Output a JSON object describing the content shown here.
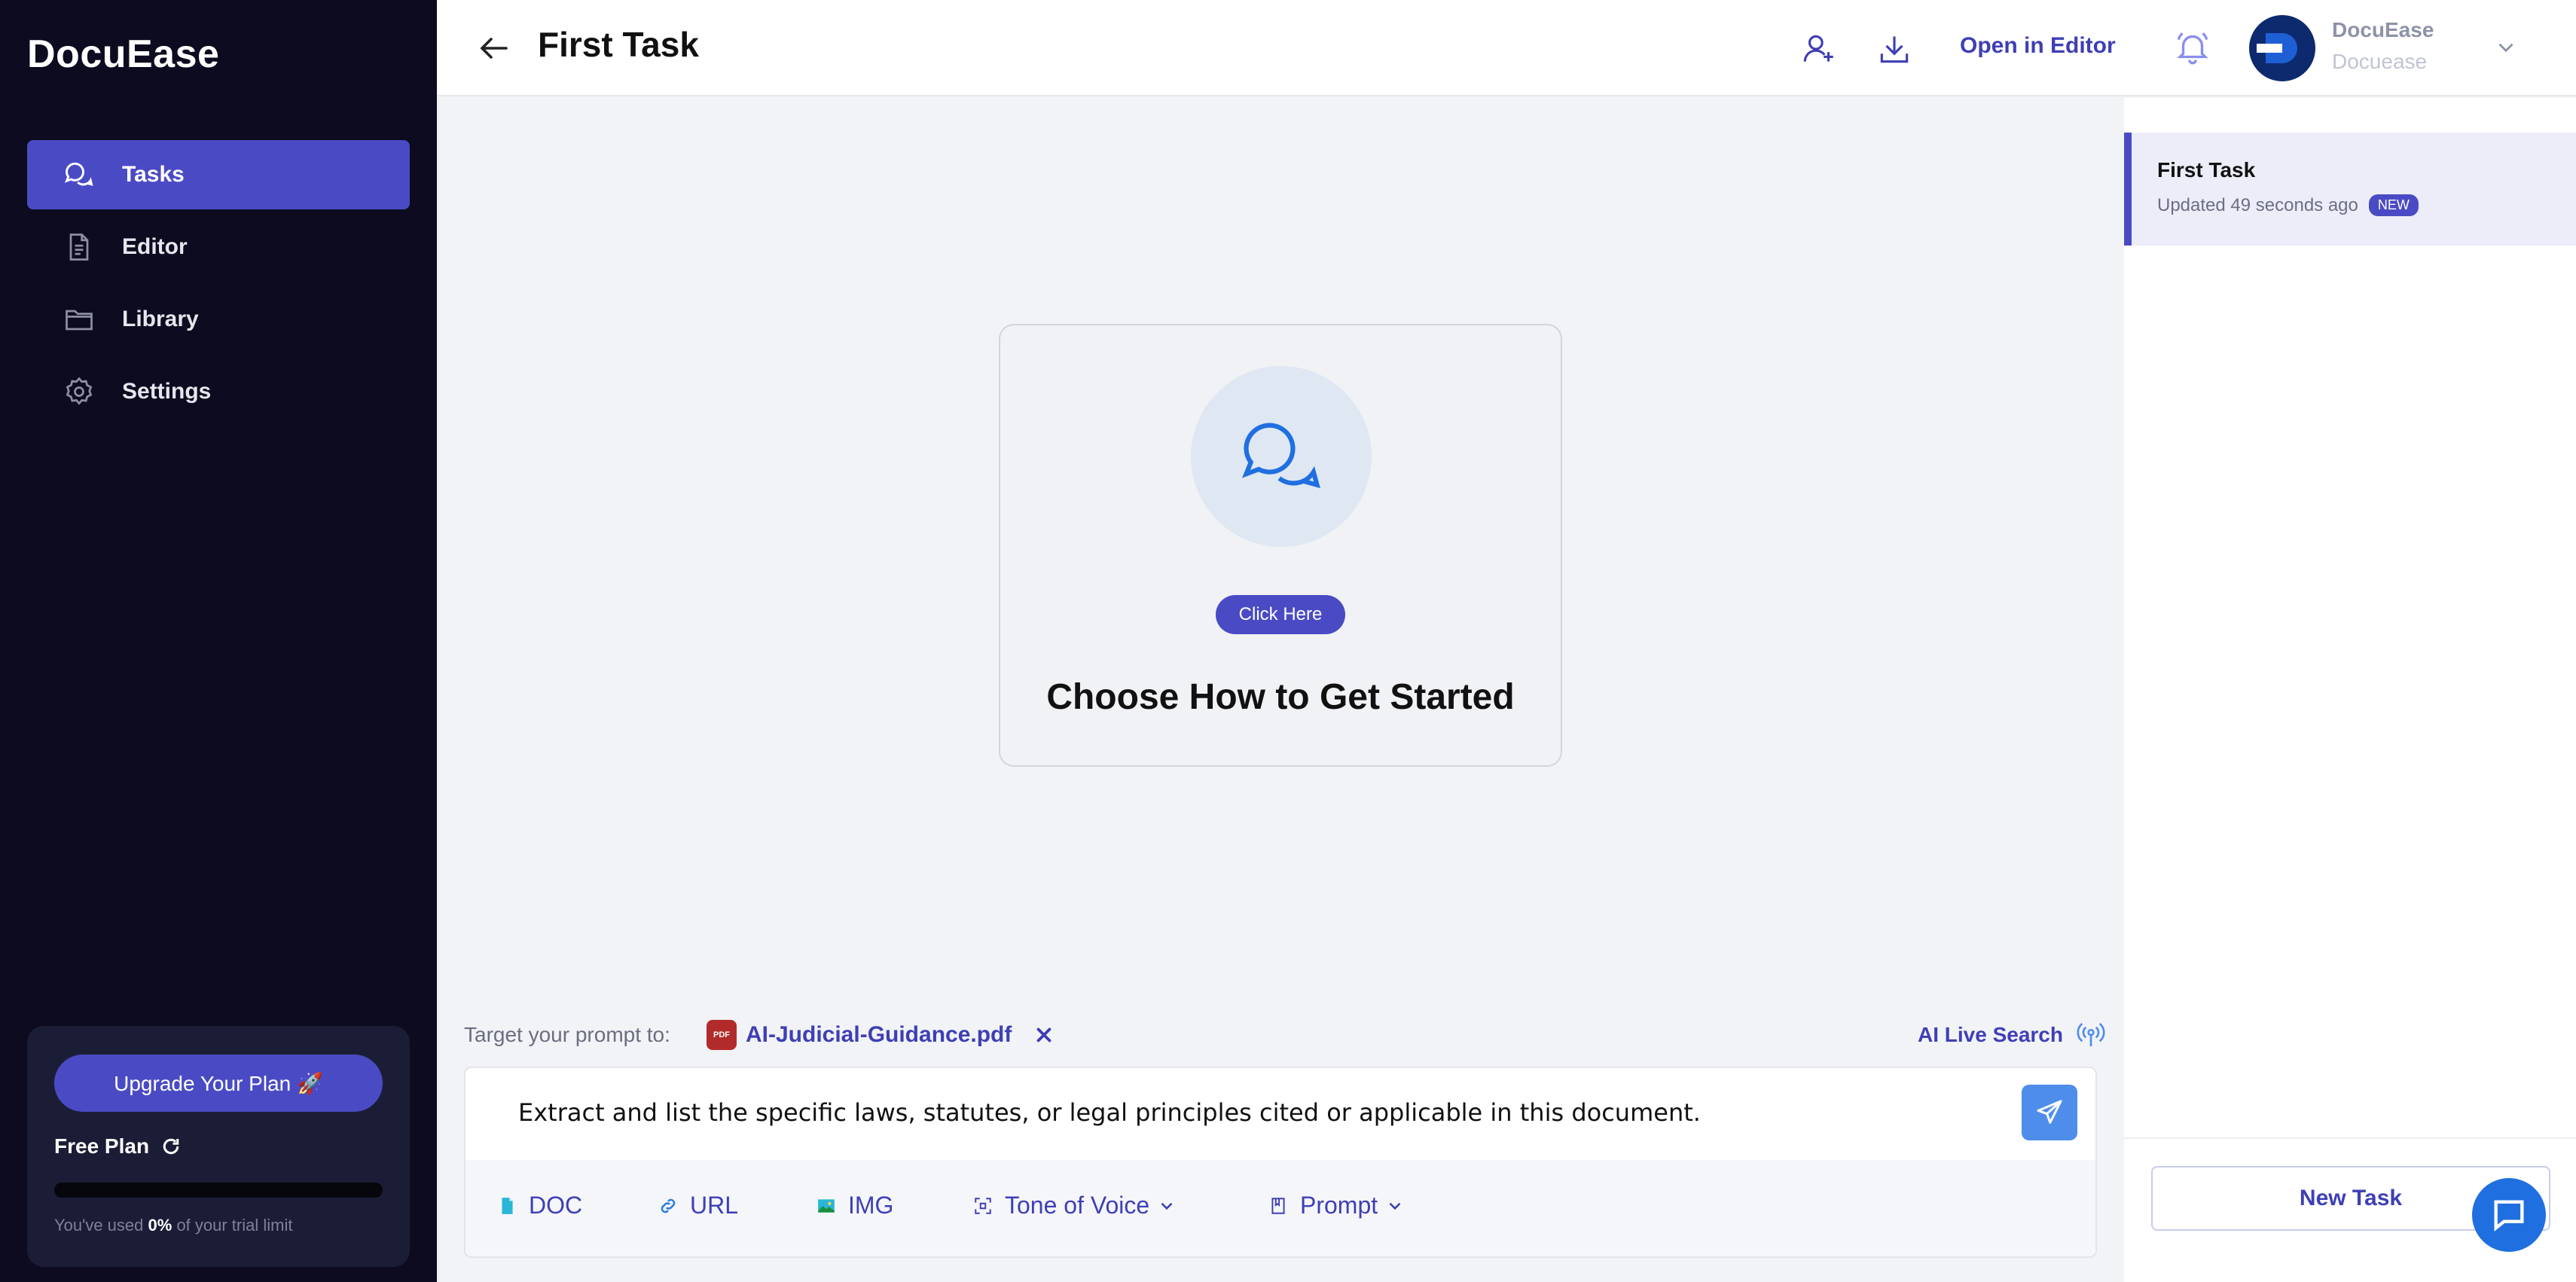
{
  "app": {
    "name": "DocuEase"
  },
  "sidebar": {
    "items": [
      {
        "label": "Tasks",
        "icon": "chat-bubbles-icon",
        "active": true
      },
      {
        "label": "Editor",
        "icon": "document-icon"
      },
      {
        "label": "Library",
        "icon": "folder-icon"
      },
      {
        "label": "Settings",
        "icon": "gear-icon"
      }
    ],
    "plan": {
      "upgrade_label": "Upgrade Your Plan 🚀",
      "plan_name": "Free Plan",
      "usage_percent": 0,
      "usage_prefix": "You've used",
      "usage_value": "0%",
      "usage_suffix": "of your trial limit"
    }
  },
  "header": {
    "title": "First Task",
    "open_editor_label": "Open in Editor",
    "user": {
      "name": "DocuEase",
      "subtitle": "Docuease"
    }
  },
  "main": {
    "start_card": {
      "button_label": "Click Here",
      "title": "Choose How to Get Started"
    },
    "target_label": "Target your prompt to:",
    "file_name": "AI-Judicial-Guidance.pdf",
    "file_type": "PDF",
    "live_search_label": "AI Live Search",
    "prompt_value": "Extract and list the specific laws, statutes, or legal principles cited or applicable in this document.",
    "tools": [
      {
        "label": "DOC",
        "icon": "doc-icon"
      },
      {
        "label": "URL",
        "icon": "link-icon"
      },
      {
        "label": "IMG",
        "icon": "image-icon"
      },
      {
        "label": "Tone of Voice",
        "icon": "tone-icon"
      },
      {
        "label": "Prompt",
        "icon": "prompt-book-icon"
      }
    ]
  },
  "right_panel": {
    "tasks": [
      {
        "title": "First Task",
        "updated": "Updated 49 seconds ago",
        "badge": "NEW"
      }
    ],
    "new_task_label": "New Task"
  },
  "colors": {
    "sidebar_bg": "#0c0b1f",
    "accent": "#4a4bc4",
    "link": "#3e3fb5",
    "send_button": "#4f8dea",
    "chat_fab": "#1f6fe0"
  }
}
